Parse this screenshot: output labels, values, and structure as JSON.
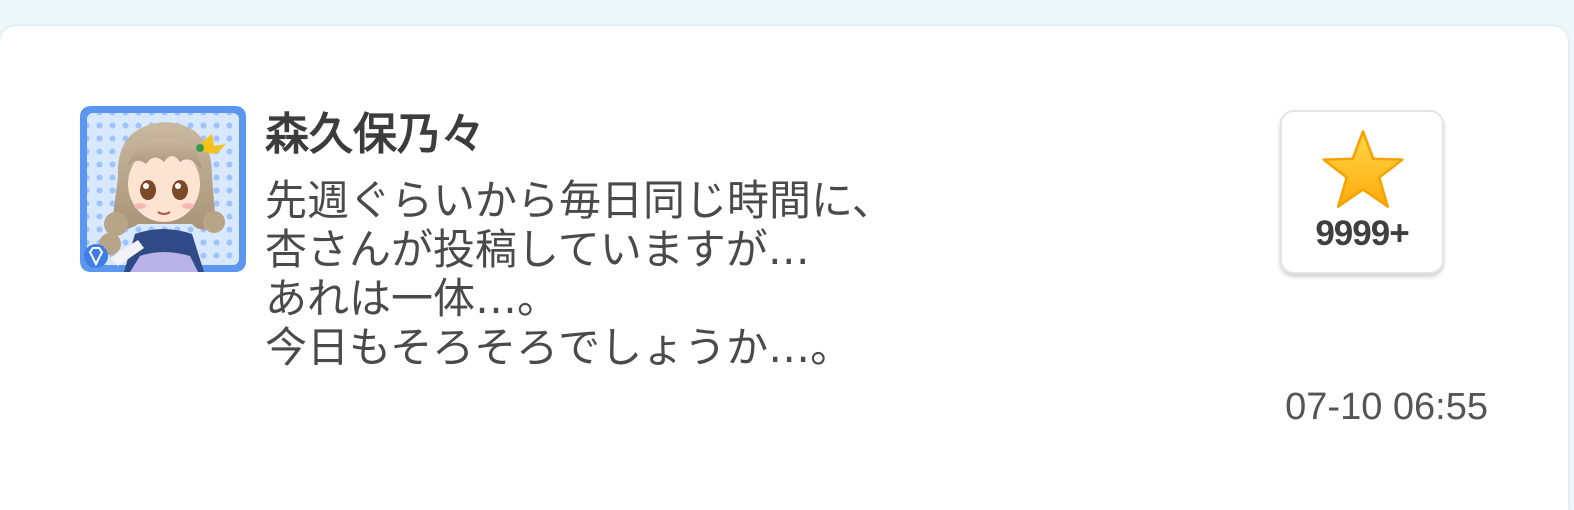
{
  "post": {
    "author": "森久保乃々",
    "message_lines": [
      "先週ぐらいから毎日同じ時間に、",
      "杏さんが投稿していますが…",
      "あれは一体…。",
      "今日もそろそろでしょうか…。"
    ],
    "like_count": "9999+",
    "timestamp": "07-10 06:55",
    "avatar_icon": "character-portrait",
    "like_icon": "star-icon"
  },
  "colors": {
    "avatar_frame": "#5b96f0",
    "avatar_bg": "#cfe2ff",
    "star": "#ffc21a",
    "text": "#4a4a4a"
  }
}
